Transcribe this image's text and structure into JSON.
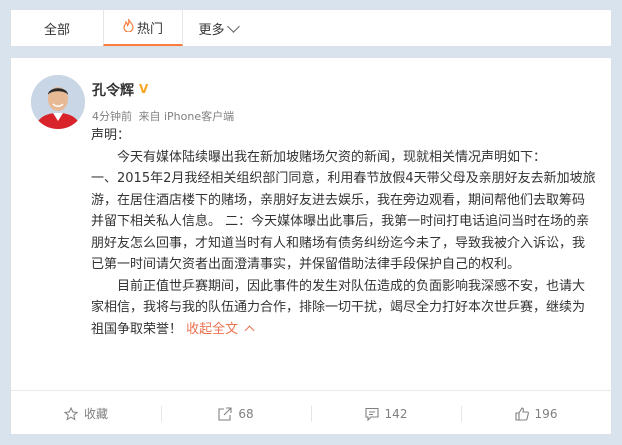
{
  "tabs": [
    {
      "label": "全部"
    },
    {
      "label": "热门"
    },
    {
      "label": "更多"
    }
  ],
  "post": {
    "author": "孔令辉",
    "verified_icon": "V",
    "time": "4分钟前",
    "source": "来自 iPhone客户端",
    "paragraphs": [
      "声明：",
      "今天有媒体陆续曝出我在新加坡赌场欠资的新闻，现就相关情况声明如下：",
      "一、2015年2月我经相关组织部门同意，利用春节放假4天带父母及亲朋好友去新加坡旅游，在居住酒店楼下的赌场，亲朋好友进去娱乐，我在旁边观看，期间帮他们去取筹码并留下相关私人信息。 二：今天媒体曝出此事后，我第一时间打电话追问当时在场的亲朋好友怎么回事，才知道当时有人和赌场有债务纠纷迄今未了，导致我被介入诉讼，我已第一时间请欠资者出面澄清事实，并保留借助法律手段保护自己的权利。",
      "目前正值世乒赛期间，因此事件的发生对队伍造成的负面影响我深感不安，也请大家相信，我将与我的队伍通力合作，排除一切干扰，竭尽全力打好本次世乒赛，继续为祖国争取荣誉！"
    ],
    "collapse_label": "收起全文"
  },
  "actions": [
    {
      "icon": "star-icon",
      "label": "收藏"
    },
    {
      "icon": "share-icon",
      "label": "68"
    },
    {
      "icon": "comment-icon",
      "label": "142"
    },
    {
      "icon": "like-icon",
      "label": "196"
    }
  ],
  "colors": {
    "accent": "#fa7d3c",
    "link": "#eb7350",
    "badge": "#f6a623",
    "background": "#d9e3ee"
  }
}
